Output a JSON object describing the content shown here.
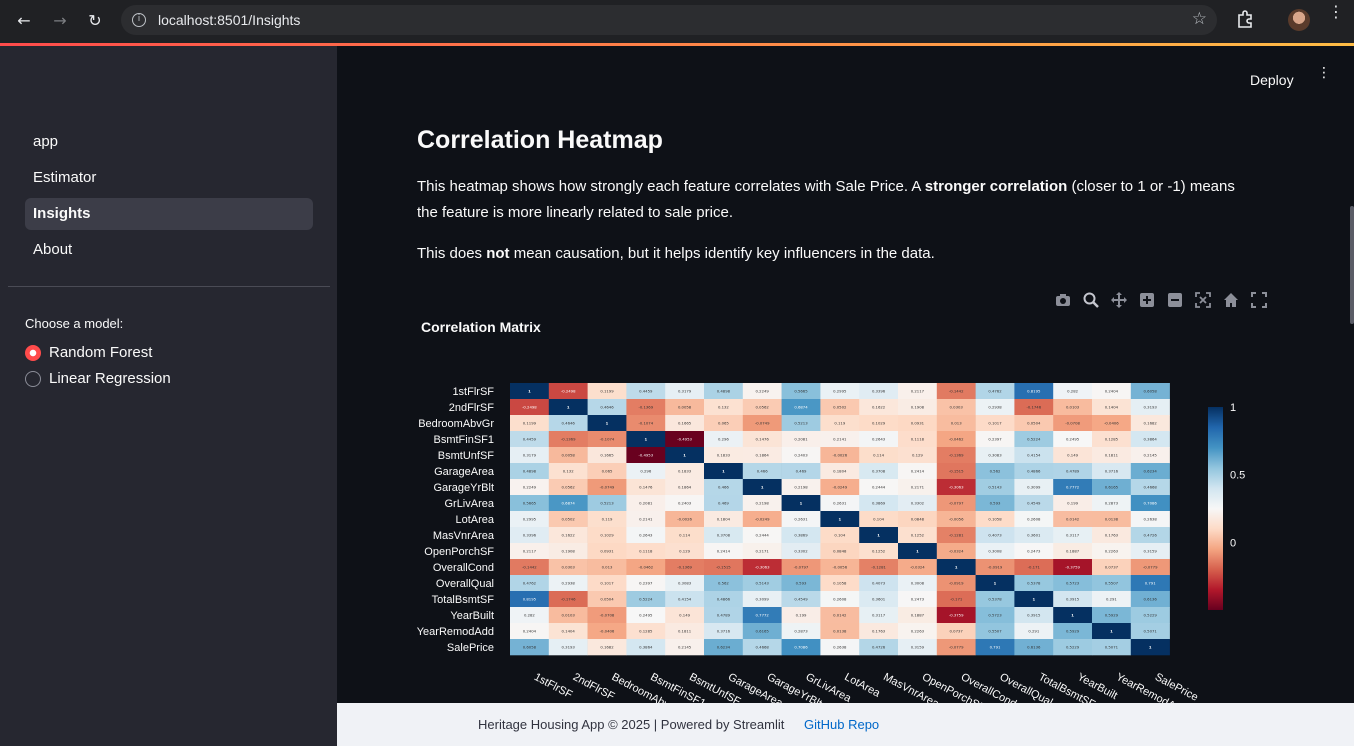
{
  "browser": {
    "url": "localhost:8501/Insights"
  },
  "sidebar": {
    "items": [
      {
        "label": "app"
      },
      {
        "label": "Estimator"
      },
      {
        "label": "Insights"
      },
      {
        "label": "About"
      }
    ],
    "model_label": "Choose a model:",
    "models": [
      {
        "label": "Random Forest",
        "checked": true
      },
      {
        "label": "Linear Regression",
        "checked": false
      }
    ]
  },
  "header": {
    "deploy_label": "Deploy"
  },
  "main": {
    "title": "Correlation Heatmap",
    "para1_a": "This heatmap shows how strongly each feature correlates with Sale Price. A ",
    "para1_b": "stronger correlation",
    "para1_c": " (closer to 1 or -1) means the feature is more linearly related to sale price.",
    "para2_a": "This does ",
    "para2_b": "not",
    "para2_c": " mean causation, but it helps identify key influencers in the data."
  },
  "footer": {
    "text": "Heritage Housing App © 2025 | Powered by Streamlit",
    "link": "GitHub Repo"
  },
  "colors": {
    "accent": "#ff4b4b",
    "positive": "#053061",
    "negative": "#67001f"
  },
  "chart_data": {
    "type": "heatmap",
    "title": "Correlation Matrix",
    "labels": [
      "1stFlrSF",
      "2ndFlrSF",
      "BedroomAbvGr",
      "BsmtFinSF1",
      "BsmtUnfSF",
      "GarageArea",
      "GarageYrBlt",
      "GrLivArea",
      "LotArea",
      "MasVnrArea",
      "OpenPorchSF",
      "OverallCond",
      "OverallQual",
      "TotalBsmtSF",
      "YearBuilt",
      "YearRemodAdd",
      "SalePrice"
    ],
    "colorbar_ticks": [
      1,
      0.5,
      0
    ],
    "zmin": -0.5,
    "zmax": 1,
    "colorscale": "RdBu",
    "matrix": [
      [
        1,
        -0.2498,
        0.1199,
        0.4459,
        0.3179,
        0.4898,
        0.2249,
        0.5665,
        0.2995,
        0.3396,
        0.2117,
        -0.1442,
        0.4762,
        0.8195,
        0.282,
        0.2404,
        0.6058
      ],
      [
        -0.2498,
        1,
        0.4646,
        -0.1369,
        0.0058,
        0.132,
        0.0562,
        0.6874,
        0.0502,
        0.1622,
        0.1908,
        0.0303,
        0.2938,
        -0.1746,
        0.0103,
        0.1404,
        0.3193
      ],
      [
        0.1199,
        0.4646,
        1,
        -0.1074,
        0.1665,
        0.065,
        -0.0749,
        0.5213,
        0.119,
        0.1029,
        0.0931,
        0.013,
        0.1017,
        0.0504,
        -0.0708,
        -0.0406,
        0.1682
      ],
      [
        0.4459,
        -0.1369,
        -0.1074,
        1,
        -0.4953,
        0.296,
        0.1476,
        0.2081,
        0.2141,
        0.2643,
        0.1118,
        -0.0462,
        0.2397,
        0.5224,
        0.2495,
        0.1285,
        0.3864
      ],
      [
        0.3179,
        0.0058,
        0.1665,
        -0.4953,
        1,
        0.1833,
        0.1864,
        0.2403,
        -0.0026,
        0.114,
        0.129,
        -0.1369,
        0.3083,
        0.4154,
        0.149,
        0.1811,
        0.2145
      ],
      [
        0.4898,
        0.132,
        0.065,
        0.296,
        0.1833,
        1,
        0.466,
        0.469,
        0.1804,
        0.3708,
        0.2414,
        -0.1515,
        0.562,
        0.4866,
        0.4789,
        0.3716,
        0.6234
      ],
      [
        0.2249,
        0.0562,
        -0.0749,
        0.1476,
        0.1864,
        0.466,
        1,
        0.2198,
        -0.0249,
        0.2444,
        0.2171,
        -0.3063,
        0.5143,
        0.3099,
        0.7772,
        0.6165,
        0.4668
      ],
      [
        0.5665,
        0.6874,
        0.5213,
        0.2081,
        0.2403,
        0.469,
        0.2198,
        1,
        0.2631,
        0.3869,
        0.3302,
        -0.0797,
        0.593,
        0.4549,
        0.199,
        0.2873,
        0.7086
      ],
      [
        0.2995,
        0.0502,
        0.119,
        0.2141,
        -0.0026,
        0.1804,
        -0.0249,
        0.2631,
        1,
        0.104,
        0.0848,
        -0.0056,
        0.1058,
        0.2608,
        0.0142,
        0.0138,
        0.2638
      ],
      [
        0.3396,
        0.1622,
        0.1029,
        0.2643,
        0.114,
        0.3708,
        0.2444,
        0.3869,
        0.104,
        1,
        0.1252,
        -0.1281,
        0.4073,
        0.3601,
        0.3117,
        0.1763,
        0.4726
      ],
      [
        0.2117,
        0.1908,
        0.0931,
        0.1118,
        0.129,
        0.2414,
        0.2171,
        0.3302,
        0.0848,
        0.1252,
        1,
        -0.0324,
        0.3008,
        0.2473,
        0.1887,
        0.2263,
        0.3159
      ],
      [
        -0.1442,
        0.0303,
        0.013,
        -0.0462,
        -0.1369,
        -0.1515,
        -0.3063,
        -0.0797,
        -0.0056,
        -0.1281,
        -0.0324,
        1,
        -0.0919,
        -0.171,
        -0.3759,
        0.0737,
        -0.0779
      ],
      [
        0.4762,
        0.2938,
        0.1017,
        0.2397,
        0.3083,
        0.562,
        0.5143,
        0.593,
        0.1058,
        0.4073,
        0.3008,
        -0.0919,
        1,
        0.5378,
        0.5723,
        0.5507,
        0.791
      ],
      [
        0.8195,
        -0.1746,
        0.0504,
        0.5224,
        0.4154,
        0.4866,
        0.3099,
        0.4549,
        0.2608,
        0.3601,
        0.2473,
        -0.171,
        0.5378,
        1,
        0.3915,
        0.291,
        0.6136
      ],
      [
        0.282,
        0.0103,
        -0.0708,
        0.2495,
        0.149,
        0.4789,
        0.7772,
        0.199,
        0.0142,
        0.3117,
        0.1887,
        -0.3759,
        0.5723,
        0.3915,
        1,
        0.5929,
        0.5229
      ],
      [
        0.2404,
        0.1404,
        -0.0406,
        0.1285,
        0.1811,
        0.3716,
        0.6165,
        0.2873,
        0.0138,
        0.1763,
        0.2263,
        0.0737,
        0.5507,
        0.291,
        0.5929,
        1,
        0.5071
      ],
      [
        0.6058,
        0.3193,
        0.1682,
        0.3864,
        0.2145,
        0.6234,
        0.4668,
        0.7086,
        0.2638,
        0.4726,
        0.3159,
        -0.0779,
        0.791,
        0.6136,
        0.5229,
        0.5071,
        1
      ]
    ]
  }
}
